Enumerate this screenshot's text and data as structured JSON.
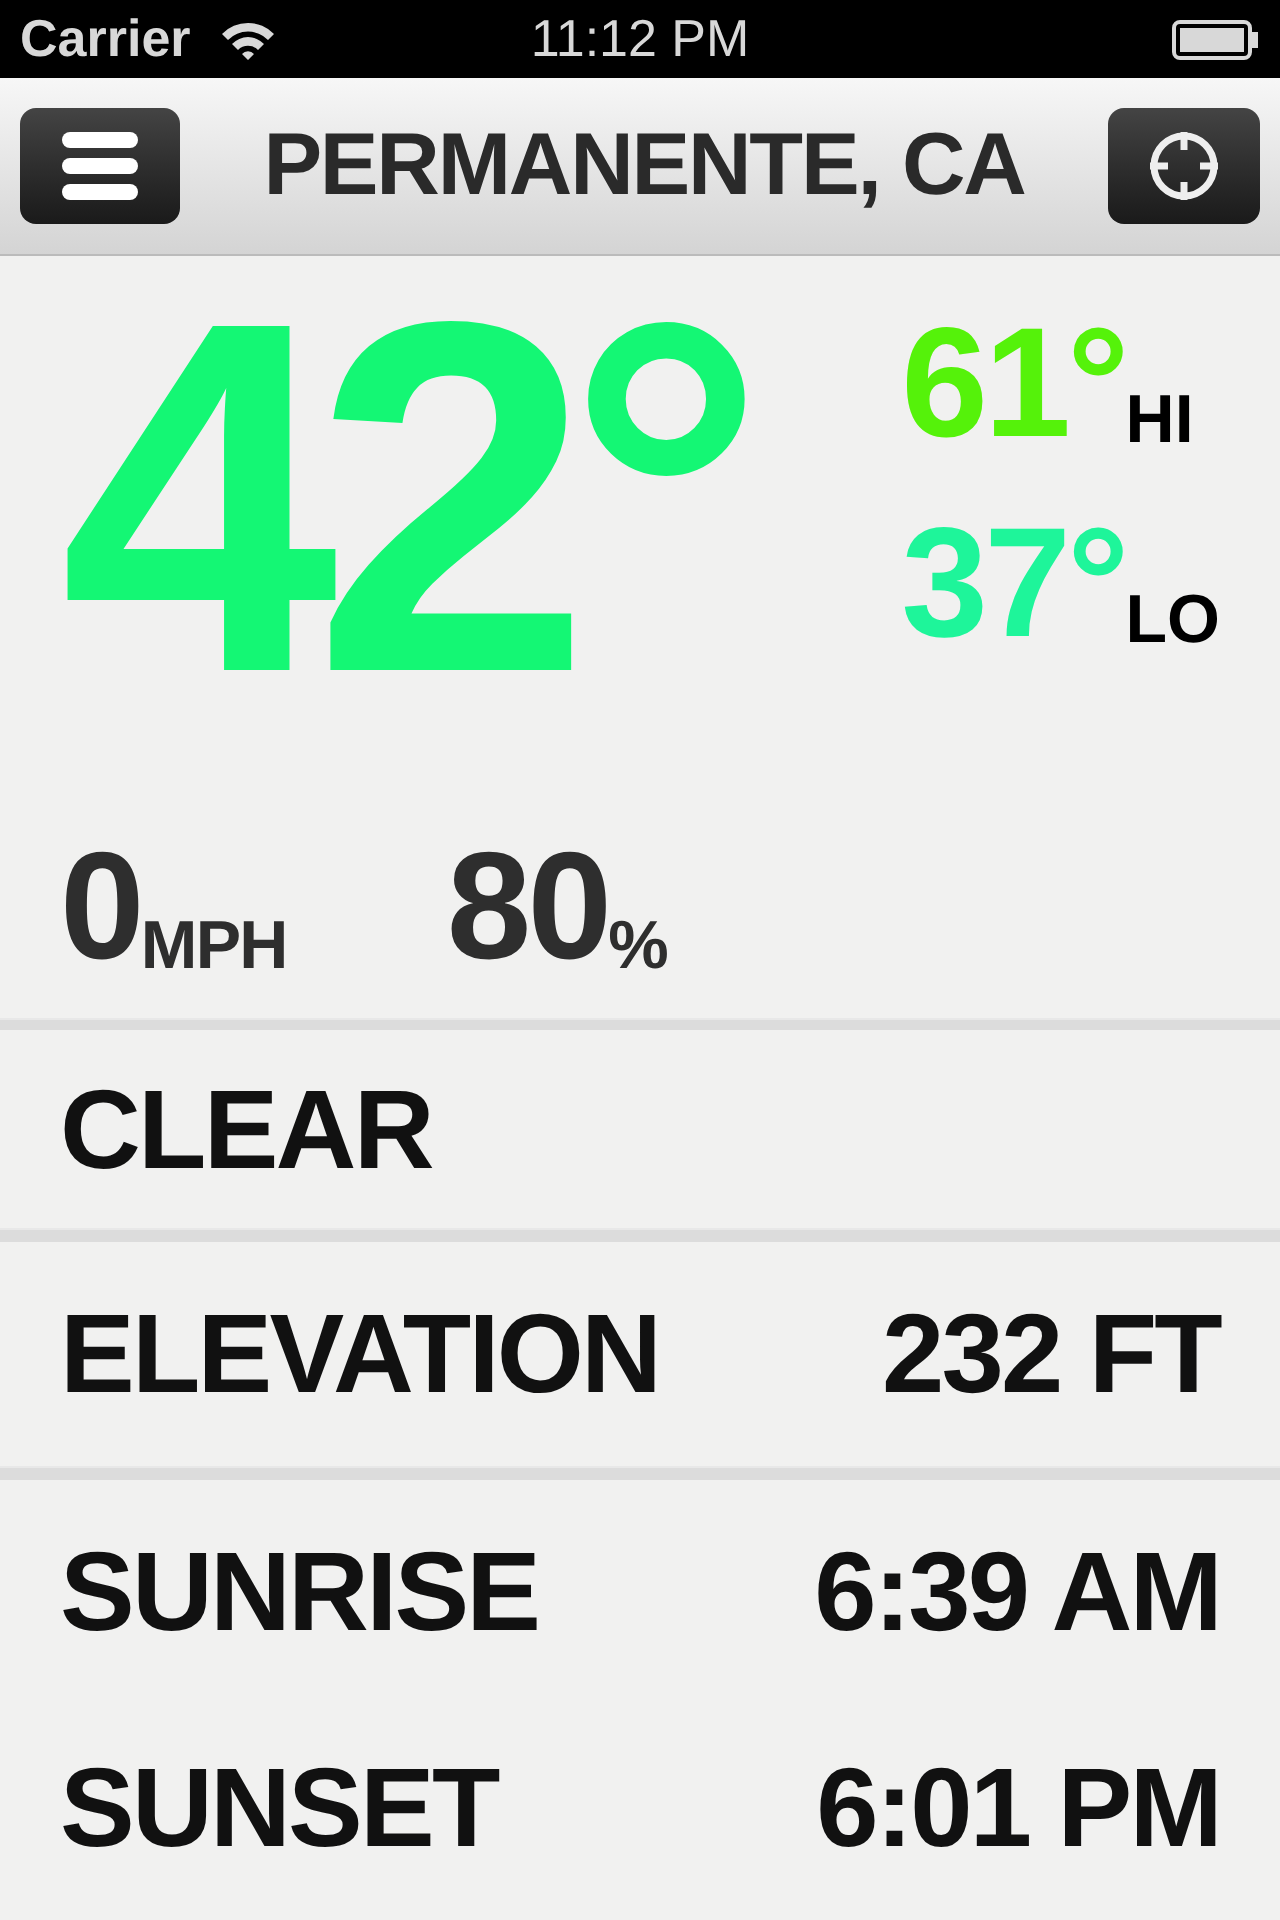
{
  "status_bar": {
    "carrier": "Carrier",
    "time": "11:12 PM"
  },
  "nav": {
    "title": "PERMANENTE, CA"
  },
  "current": {
    "temperature": "42°",
    "color": "#14f774"
  },
  "forecast": [
    {
      "temperature": "61°",
      "label": "HI",
      "color": "#55f20a"
    },
    {
      "temperature": "37°",
      "label": "LO",
      "color": "#1ef59a"
    }
  ],
  "stats": [
    {
      "value": "0",
      "unit": "MPH"
    },
    {
      "value": "80",
      "unit": "%"
    }
  ],
  "condition": "CLEAR",
  "sections": [
    {
      "rows": [
        {
          "label": "ELEVATION",
          "value": "232 FT"
        }
      ]
    },
    {
      "rows": [
        {
          "label": "SUNRISE",
          "value": "6:39 AM"
        },
        {
          "label": "SUNSET",
          "value": "6:01 PM"
        }
      ]
    }
  ]
}
